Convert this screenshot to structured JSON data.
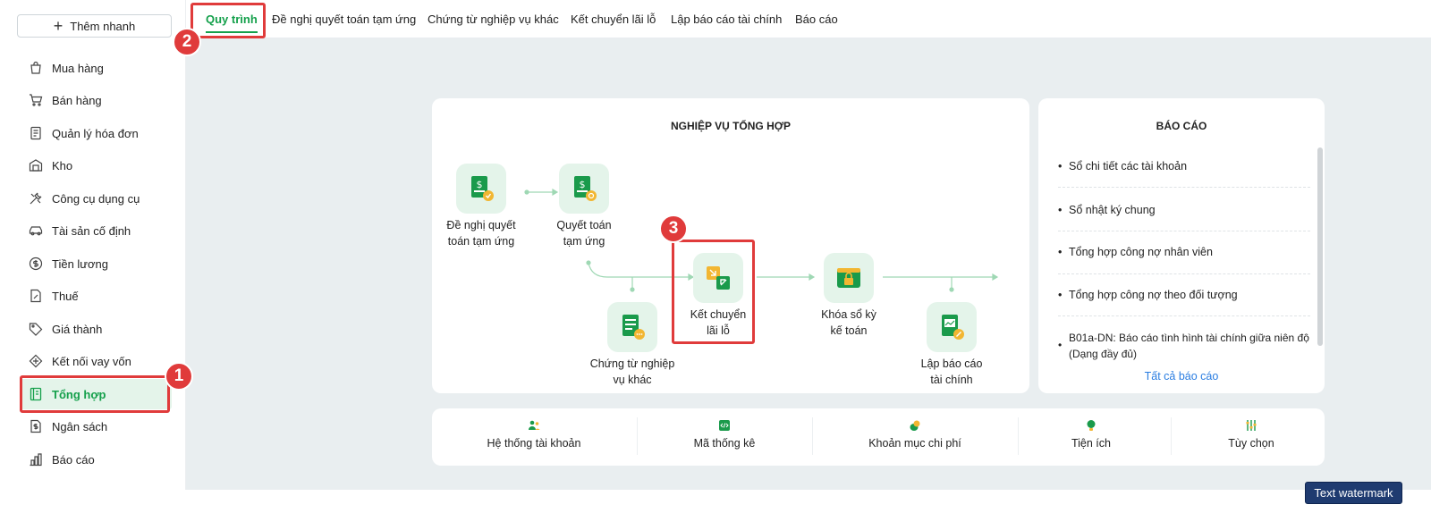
{
  "sidebar": {
    "quick_add": "Thêm nhanh",
    "items": [
      {
        "label": "Mua hàng",
        "icon": "shopping-bag-icon"
      },
      {
        "label": "Bán hàng",
        "icon": "cart-icon"
      },
      {
        "label": "Quản lý hóa đơn",
        "icon": "invoice-icon"
      },
      {
        "label": "Kho",
        "icon": "warehouse-icon"
      },
      {
        "label": "Công cụ dụng cụ",
        "icon": "tools-icon"
      },
      {
        "label": "Tài sản cố định",
        "icon": "car-icon"
      },
      {
        "label": "Tiền lương",
        "icon": "dollar-circle-icon"
      },
      {
        "label": "Thuế",
        "icon": "tax-icon"
      },
      {
        "label": "Giá thành",
        "icon": "price-tag-icon"
      },
      {
        "label": "Kết nối vay vốn",
        "icon": "loan-icon"
      },
      {
        "label": "Tổng hợp",
        "icon": "book-icon",
        "active": true
      },
      {
        "label": "Ngân sách",
        "icon": "budget-icon"
      },
      {
        "label": "Báo cáo",
        "icon": "bar-chart-icon"
      }
    ]
  },
  "tabs": [
    {
      "label": "Quy trình",
      "active": true
    },
    {
      "label": "Đề nghị quyết toán tạm ứng"
    },
    {
      "label": "Chứng từ nghiệp vụ khác"
    },
    {
      "label": "Kết chuyển lãi lỗ"
    },
    {
      "label": "Lập báo cáo tài chính"
    },
    {
      "label": "Báo cáo"
    }
  ],
  "flow": {
    "title": "NGHIỆP VỤ TỔNG HỢP",
    "nodes": {
      "de_nghi": "Đề nghị quyết toán tạm ứng",
      "quyet_toan": "Quyết toán tạm ứng",
      "chung_tu": "Chứng từ nghiệp vụ khác",
      "ket_chuyen": "Kết chuyển lãi lỗ",
      "khoa_so": "Khóa sổ kỳ kế toán",
      "lap_bao_cao": "Lập báo cáo tài chính"
    }
  },
  "reports": {
    "title": "BÁO CÁO",
    "items": [
      "Sổ chi tiết các tài khoản",
      "Sổ nhật ký chung",
      "Tổng hợp công nợ nhân viên",
      "Tổng hợp công nợ theo đối tượng",
      "B01a-DN: Báo cáo tình hình tài chính giữa niên độ (Dạng đầy đủ)"
    ],
    "all_link": "Tất cả báo cáo"
  },
  "tools": [
    {
      "label": "Hệ thống tài khoản",
      "icon": "users-icon"
    },
    {
      "label": "Mã thống kê",
      "icon": "code-icon"
    },
    {
      "label": "Khoản mục chi phí",
      "icon": "coins-icon"
    },
    {
      "label": "Tiện ích",
      "icon": "lightbulb-icon"
    },
    {
      "label": "Tùy chọn",
      "icon": "sliders-icon"
    }
  ],
  "markers": [
    "1",
    "2",
    "3"
  ],
  "watermark": "Text watermark",
  "colors": {
    "accent": "#14a04b",
    "marker": "#e03b3b",
    "link": "#2a7de1",
    "icon_bg": "#e4f4ea"
  }
}
